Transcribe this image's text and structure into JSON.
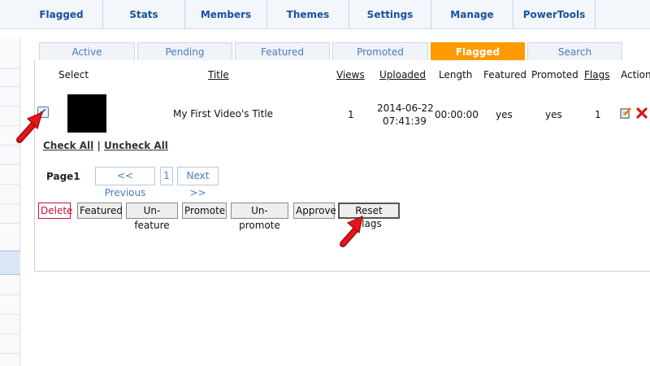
{
  "topnav": [
    "Flagged",
    "Stats",
    "Members",
    "Themes",
    "Settings",
    "Manage",
    "PowerTools"
  ],
  "subtabs": [
    "Active",
    "Pending",
    "Featured",
    "Promoted",
    "Flagged",
    "Search"
  ],
  "table": {
    "headers": {
      "select": "Select",
      "title": "Title",
      "views": "Views",
      "uploaded": "Uploaded",
      "length": "Length",
      "featured": "Featured",
      "promoted": "Promoted",
      "flags": "Flags",
      "action": "Action"
    },
    "row": {
      "checked": "✔",
      "title": "My First Video's Title",
      "views": "1",
      "uploaded_date": "2014-06-22",
      "uploaded_time": "07:41:39",
      "length": "00:00:00",
      "featured": "yes",
      "promoted": "yes",
      "flags": "1"
    }
  },
  "selection": {
    "check_all": "Check All",
    "separator": "|",
    "uncheck_all": "Uncheck All"
  },
  "pager": {
    "label": "Page1",
    "prev": "<< Previous",
    "page": "1",
    "next": "Next >>"
  },
  "actions": {
    "delete": "Delete",
    "featured": "Featured",
    "unfeature": "Un-feature",
    "promote": "Promote",
    "unpromote": "Un-promote",
    "approve": "Approve",
    "reset_flags": "Reset Flags"
  },
  "colors": {
    "accent": "#ff9900",
    "link": "#1a52a0",
    "danger": "#c8102e",
    "arrow": "#e8141b"
  }
}
